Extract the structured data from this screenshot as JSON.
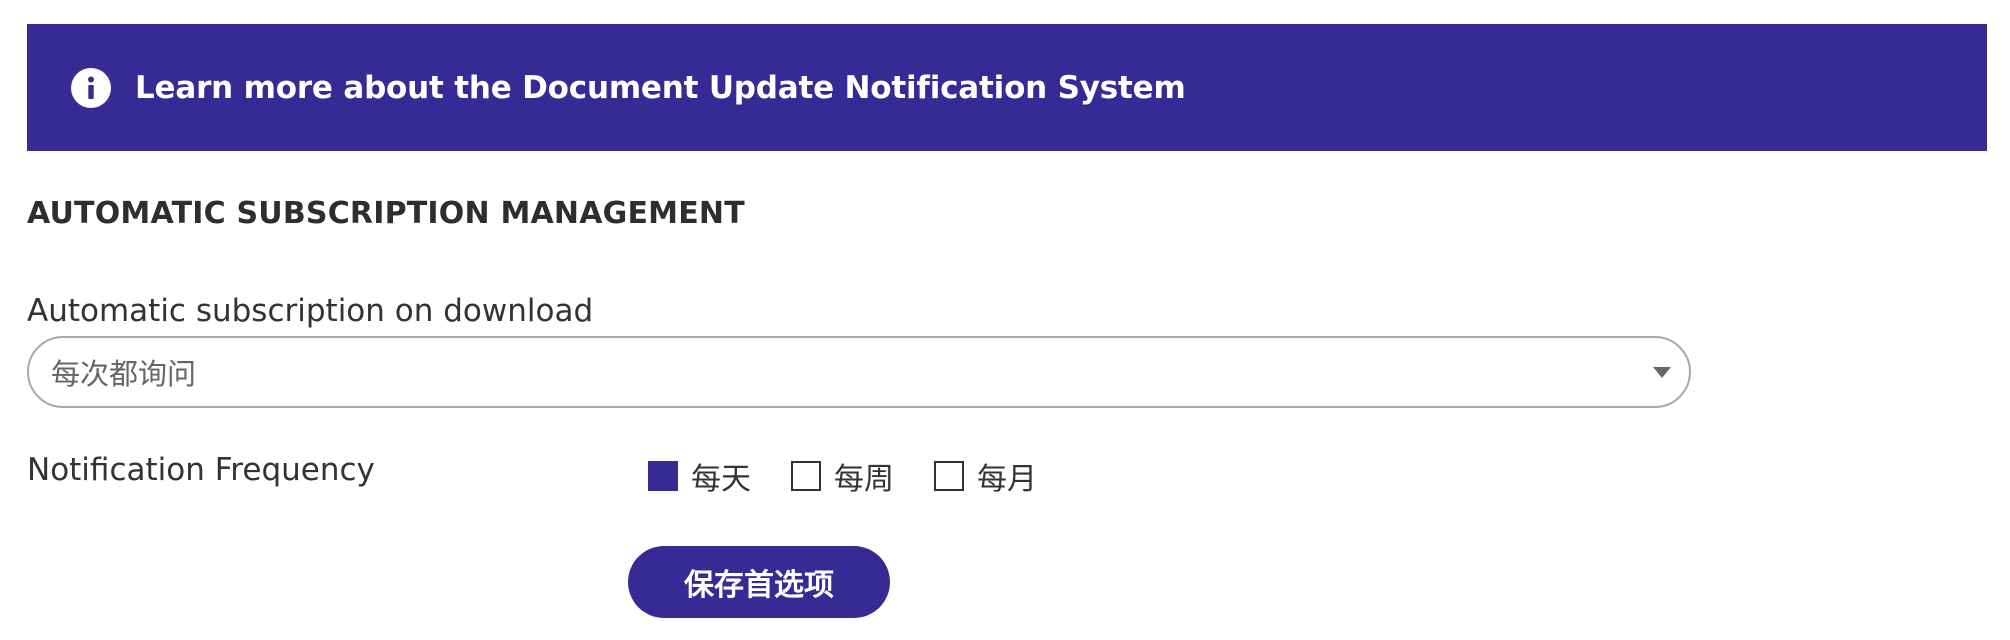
{
  "banner": {
    "text": "Learn more about the Document Update Notification System",
    "icon": "info-icon"
  },
  "section": {
    "title": "AUTOMATIC SUBSCRIPTION MANAGEMENT"
  },
  "auto_subscription": {
    "label": "Automatic subscription on download",
    "selected": "每次都询问",
    "icon": "chevron-down-icon"
  },
  "frequency": {
    "label": "Notification Frequency",
    "options": [
      {
        "label": "每天",
        "checked": true
      },
      {
        "label": "每周",
        "checked": false
      },
      {
        "label": "每月",
        "checked": false
      }
    ]
  },
  "actions": {
    "save_label": "保存首选项"
  },
  "colors": {
    "accent": "#372a94",
    "text": "#333333",
    "border": "#a9a9a9"
  }
}
